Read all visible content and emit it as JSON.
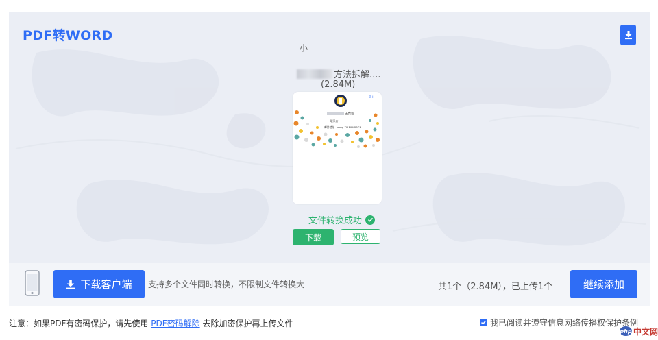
{
  "header": {
    "title": "PDF转WORD"
  },
  "file": {
    "name_visible": "方法拆解....",
    "size": "(2.84M)",
    "thumbnail": {
      "badge": "ZH",
      "name_suffix": "王虎超",
      "line1": "联系方",
      "line2": "邮件地址",
      "line3": "wang 70 104 2071"
    },
    "status": "文件转换成功",
    "download_label": "下载",
    "preview_label": "预览"
  },
  "bottom_bar": {
    "client_button": "下载客户端",
    "support_text": "支持多个文件同时转换，不限制文件转换大",
    "support_tail": "小",
    "count_text": "共1个（2.84M），已上传1个",
    "add_button": "继续添加"
  },
  "footer": {
    "notice_prefix": "注意：如果PDF有密码保护，请先使用",
    "notice_link": "PDF密码解除",
    "notice_suffix": "去除加密保护再上传文件",
    "agree_text": "我已阅读并遵守信息网络传播权保护条例",
    "agree_checked": true
  },
  "watermark": {
    "badge": "php",
    "text": "中文网"
  },
  "colors": {
    "brand_blue": "#2f6df5",
    "success_green": "#2db36f",
    "panel_bg": "#ebeef5"
  }
}
